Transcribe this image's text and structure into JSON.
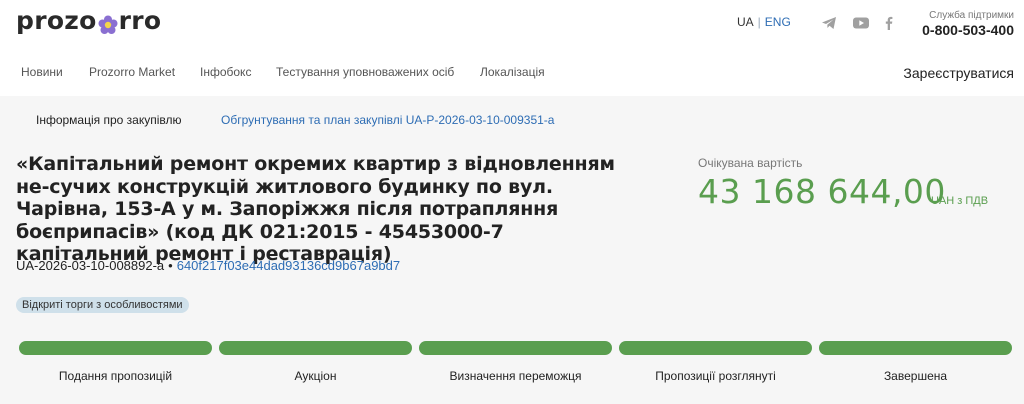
{
  "header": {
    "logo_prefix": "prozo",
    "logo_suffix": "rro",
    "lang_active": "UA",
    "lang_other": "ENG",
    "support_label": "Служба підтримки",
    "support_phone": "0-800-503-400",
    "social_icons": [
      "telegram-icon",
      "youtube-icon",
      "facebook-icon"
    ]
  },
  "nav": {
    "items": [
      "Новини",
      "Prozorro Market",
      "Інфобокс",
      "Тестування уповноважених осіб",
      "Локалізація"
    ],
    "register": "Зареєструватися"
  },
  "tabs": {
    "info": "Інформація про закупівлю",
    "plan": "Обгрунтування та план закупівлі UA-P-2026-03-10-009351-a"
  },
  "tender": {
    "title": "«Капітальний ремонт окремих квартир з відновленням не-сучих конструкцій житлового будинку по вул. Чарівна, 153-А у м. Запоріжжя після потрапляння боєприпасів» (код ДК 021:2015 - 45453000-7 капітальний ремонт і реставрація)",
    "id": "UA-2026-03-10-008892-a",
    "separator": "•",
    "hash": "640f217f03e44dad93136cd9b67a9bd7",
    "procedure_badge": "Відкриті торги з особливостями",
    "expected_cost_label": "Очікувана вартість",
    "expected_cost_value": "43 168 644,00",
    "currency": "UAH з ПДВ"
  },
  "stages": [
    "Подання пропозицій",
    "Аукціон",
    "Визначення переможця",
    "Пропозиції розглянуті",
    "Завершена"
  ],
  "colors": {
    "accent_green": "#5a9e4f",
    "link_blue": "#2e6db4",
    "logo_flower": "#8a6fd1",
    "badge_bg": "#cfe0ea",
    "content_bg": "#f6f6f6"
  }
}
